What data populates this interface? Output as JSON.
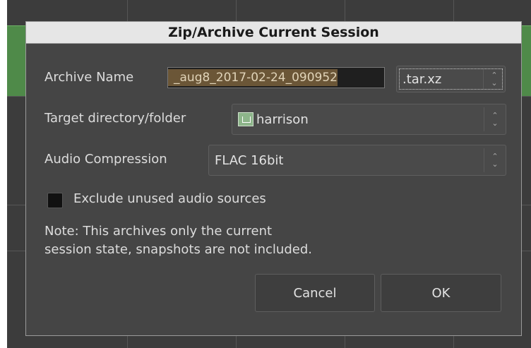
{
  "dialog": {
    "title": "Zip/Archive Current Session",
    "archive_name_label": "Archive Name",
    "archive_name_value": "_aug8_2017-02-24_090952",
    "extension_value": ".tar.xz",
    "target_dir_label": "Target directory/folder",
    "target_dir_value": "harrison",
    "target_dir_icon": "home-folder-icon",
    "audio_compression_label": "Audio Compression",
    "audio_compression_value": "FLAC 16bit",
    "exclude_unused_label": "Exclude unused audio sources",
    "exclude_unused_checked": false,
    "note_line1": "Note: This archives only the current",
    "note_line2": "session state, snapshots are not included.",
    "cancel_label": "Cancel",
    "ok_label": "OK"
  },
  "colors": {
    "dialog_bg": "#454545",
    "titlebar_bg": "#e6e6e6",
    "selection_bg": "#6b5637",
    "track_green": "#4f8a49"
  }
}
